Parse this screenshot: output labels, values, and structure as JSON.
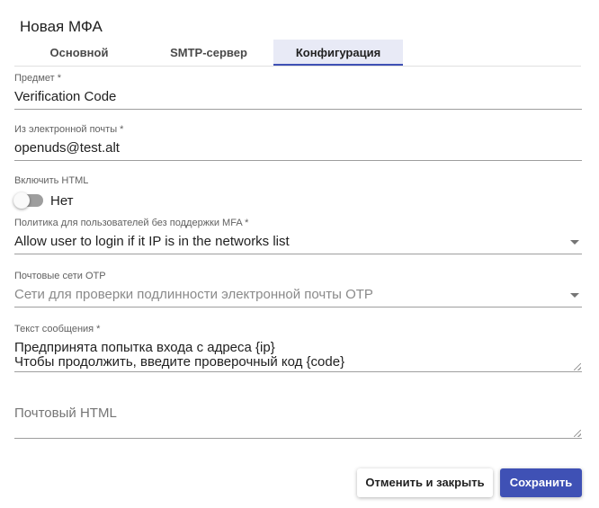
{
  "dialog": {
    "title": "Новая МФА"
  },
  "tabs": [
    {
      "label": "Основной"
    },
    {
      "label": "SMTP-сервер"
    },
    {
      "label": "Конфигурация"
    }
  ],
  "fields": {
    "subject": {
      "label": "Предмет *",
      "value": "Verification Code"
    },
    "from_email": {
      "label": "Из электронной почты *",
      "value": "openuds@test.alt"
    },
    "enable_html": {
      "label": "Включить HTML",
      "state_text": "Нет",
      "checked": false
    },
    "policy": {
      "label": "Политика для пользователей без поддержки MFA *",
      "value": "Allow user to login if it IP is in the networks list"
    },
    "otp_networks": {
      "label": "Почтовые сети OTP",
      "placeholder": "Сети для проверки подлинности электронной почты OTP"
    },
    "message_text": {
      "label": "Текст сообщения *",
      "value": "Предпринята попытка входа с адреса {ip}\nЧтобы продолжить, введите проверочный код {code}"
    },
    "mail_html": {
      "placeholder": "Почтовый HTML"
    }
  },
  "buttons": {
    "cancel": "Отменить и закрыть",
    "save": "Сохранить"
  },
  "colors": {
    "accent": "#3f51b5",
    "active_tab_bg": "#e8eaf6"
  }
}
